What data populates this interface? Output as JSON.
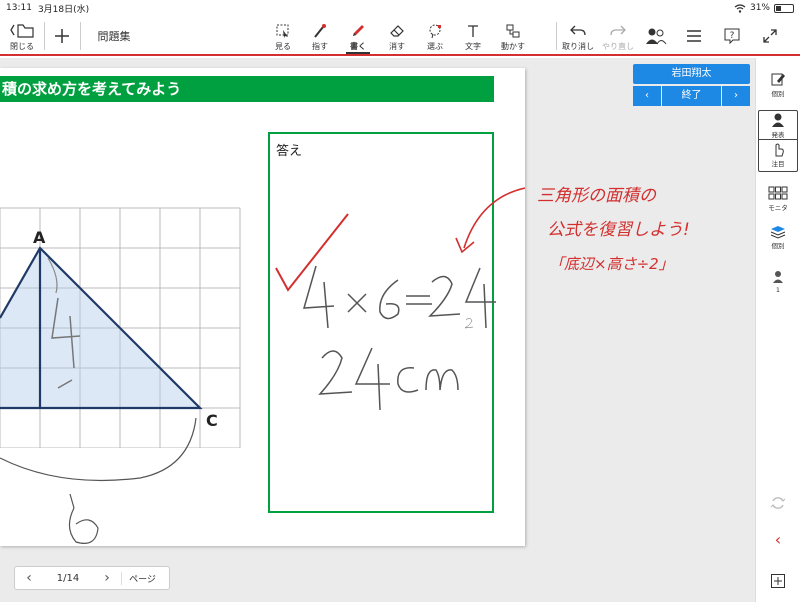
{
  "status_bar": {
    "time": "13:11",
    "date": "3月18日(水)",
    "battery": "31%",
    "battery_level": 0.31
  },
  "toolbar": {
    "close_label": "閉じる",
    "title": "問題集",
    "tools": [
      {
        "label": "見る",
        "icon": "view-icon"
      },
      {
        "label": "指す",
        "icon": "pointer-icon"
      },
      {
        "label": "書く",
        "icon": "pen-icon",
        "active": true
      },
      {
        "label": "消す",
        "icon": "eraser-icon"
      },
      {
        "label": "選ぶ",
        "icon": "lasso-icon"
      },
      {
        "label": "文字",
        "icon": "text-icon"
      },
      {
        "label": "動かす",
        "icon": "move-icon"
      }
    ],
    "undo_label": "取り消し",
    "redo_label": "やり直し"
  },
  "sheet": {
    "banner_text": "積の求め方を考えてみよう",
    "answer_label": "答え",
    "vertex_a": "A",
    "vertex_c": "C"
  },
  "student_panel": {
    "name": "岩田翔太",
    "end_label": "終了"
  },
  "sidebar": {
    "items": [
      {
        "label": "個別",
        "icon": "individual-edit-icon"
      },
      {
        "label": "発表",
        "icon": "present-icon"
      },
      {
        "label": "注目",
        "icon": "attention-icon"
      },
      {
        "label": "モニタ",
        "icon": "monitor-icon"
      },
      {
        "label": "個別",
        "icon": "layers-icon"
      },
      {
        "label": "1",
        "icon": "user-count-icon"
      }
    ]
  },
  "pager": {
    "page": "1/14",
    "page_label": "ページ"
  },
  "colors": {
    "accent_red": "#d32f2f",
    "green": "#00a040",
    "blue": "#1e88e5"
  }
}
